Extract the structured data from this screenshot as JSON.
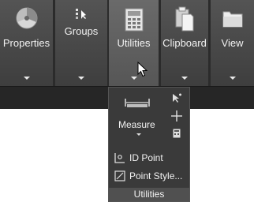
{
  "ribbon": {
    "panels": [
      {
        "label": "Properties",
        "icon": "color-wheel-icon"
      },
      {
        "label": "Groups",
        "icon": "group-select-icon"
      },
      {
        "label": "Utilities",
        "icon": "calculator-icon"
      },
      {
        "label": "Clipboard",
        "icon": "clipboard-icon"
      },
      {
        "label": "View",
        "icon": "folder-view-icon"
      }
    ]
  },
  "utilities_dropdown": {
    "measure_label": "Measure",
    "id_point_label": "ID Point",
    "point_style_label": "Point Style...",
    "footer_label": "Utilities"
  },
  "colors": {
    "ribbon_bg": "#2b2b2b",
    "panel_bg": "#4a4a4a",
    "active_panel_bg": "#626262",
    "dropdown_bg": "#3a3a3a",
    "text": "#f2f2f2"
  }
}
